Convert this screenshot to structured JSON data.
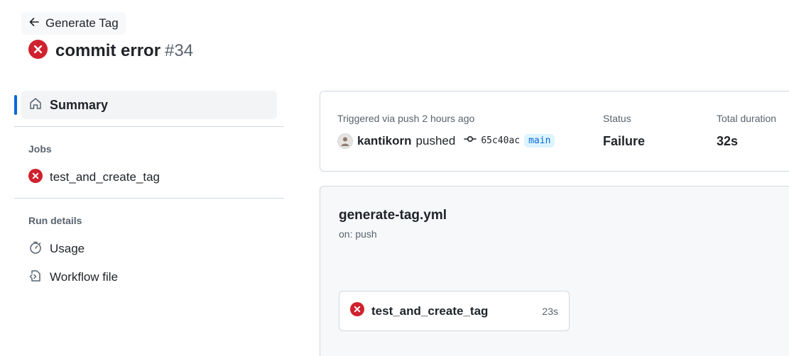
{
  "header": {
    "back_label": "Generate Tag",
    "title": "commit error",
    "run_number": "#34"
  },
  "sidebar": {
    "summary_label": "Summary",
    "jobs_heading": "Jobs",
    "jobs": [
      {
        "label": "test_and_create_tag",
        "status": "failure"
      }
    ],
    "run_details_heading": "Run details",
    "run_details": [
      {
        "label": "Usage",
        "icon": "stopwatch-icon"
      },
      {
        "label": "Workflow file",
        "icon": "file-code-icon"
      }
    ]
  },
  "summary": {
    "trigger_text": "Triggered via push 2 hours ago",
    "user": "kantikorn",
    "action": "pushed",
    "commit_sha": "65c40ac",
    "branch": "main",
    "status_label": "Status",
    "status_value": "Failure",
    "duration_label": "Total duration",
    "duration_value": "32s"
  },
  "workflow": {
    "file_name": "generate-tag.yml",
    "trigger": "on: push",
    "job": {
      "name": "test_and_create_tag",
      "duration": "23s",
      "status": "failure"
    }
  },
  "colors": {
    "error": "#cf222e",
    "accent": "#0969da",
    "branch_bg": "#ddf4ff"
  }
}
